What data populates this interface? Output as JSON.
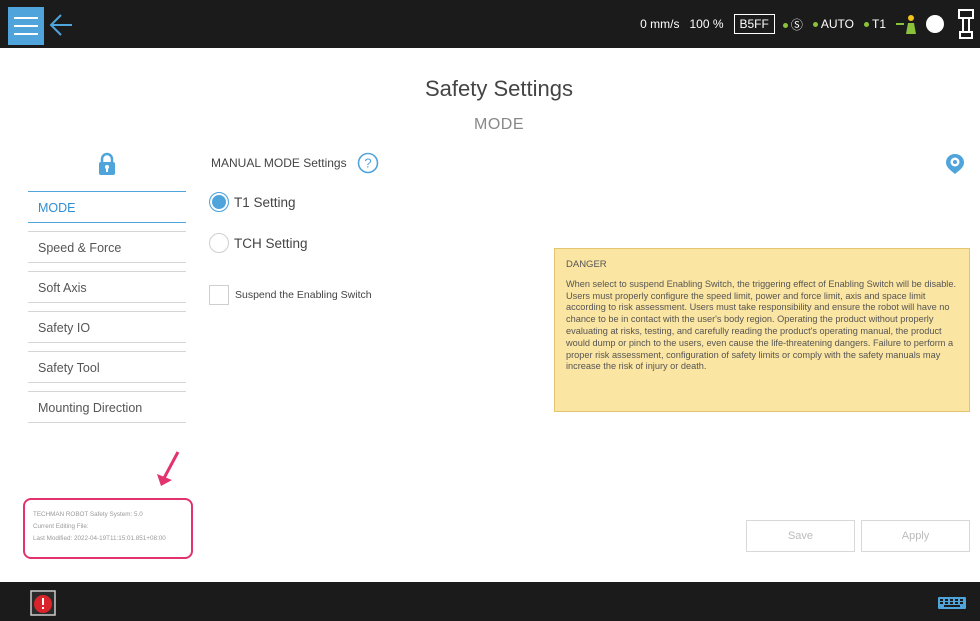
{
  "topbar": {
    "speed": "0 mm/s",
    "percent": "100 %",
    "code": "B5FF",
    "mode": "AUTO",
    "t1": "T1"
  },
  "page": {
    "title": "Safety Settings",
    "subtitle": "MODE"
  },
  "sidebar": {
    "items": [
      {
        "label": "MODE"
      },
      {
        "label": "Speed & Force"
      },
      {
        "label": "Soft Axis"
      },
      {
        "label": "Safety IO"
      },
      {
        "label": "Safety Tool"
      },
      {
        "label": "Mounting Direction"
      }
    ]
  },
  "main": {
    "section_title": "MANUAL MODE Settings",
    "radio_t1": "T1 Setting",
    "radio_tch": "TCH Setting",
    "checkbox_label": "Suspend the Enabling Switch",
    "danger_title": "DANGER",
    "danger_text": "When select to suspend Enabling Switch, the triggering effect of Enabling Switch will be disable. Users must properly configure the speed limit, power and force limit, axis and space limit according to risk assessment. Users must take responsibility and ensure the robot will have no chance to be in contact with the user's body region. Operating the product without properly evaluating at risks, testing, and carefully reading the product's operating manual, the product would dump or pinch to the users, even cause the life-threatening dangers. Failure to perform a proper risk assessment, configuration of safety limits or comply with the safety manuals may increase the risk of injury or death.",
    "save_label": "Save",
    "apply_label": "Apply"
  },
  "info": {
    "system": "TECHMAN ROBOT Safety System:  5.0",
    "editing": "Current Editing File:",
    "modified": "Last Modified:  2022-04-19T11:15:01.851+08:00"
  },
  "icons": {
    "menu": "menu-icon",
    "back": "back-arrow-icon",
    "lock": "lock-icon",
    "help": "help-icon",
    "locate": "location-icon",
    "error": "error-icon",
    "keyboard": "keyboard-icon"
  },
  "colors": {
    "accent": "#4fa4dc",
    "danger_bg": "#fbe5a2",
    "highlight": "#e2336e",
    "status_green": "#8ac33a"
  }
}
